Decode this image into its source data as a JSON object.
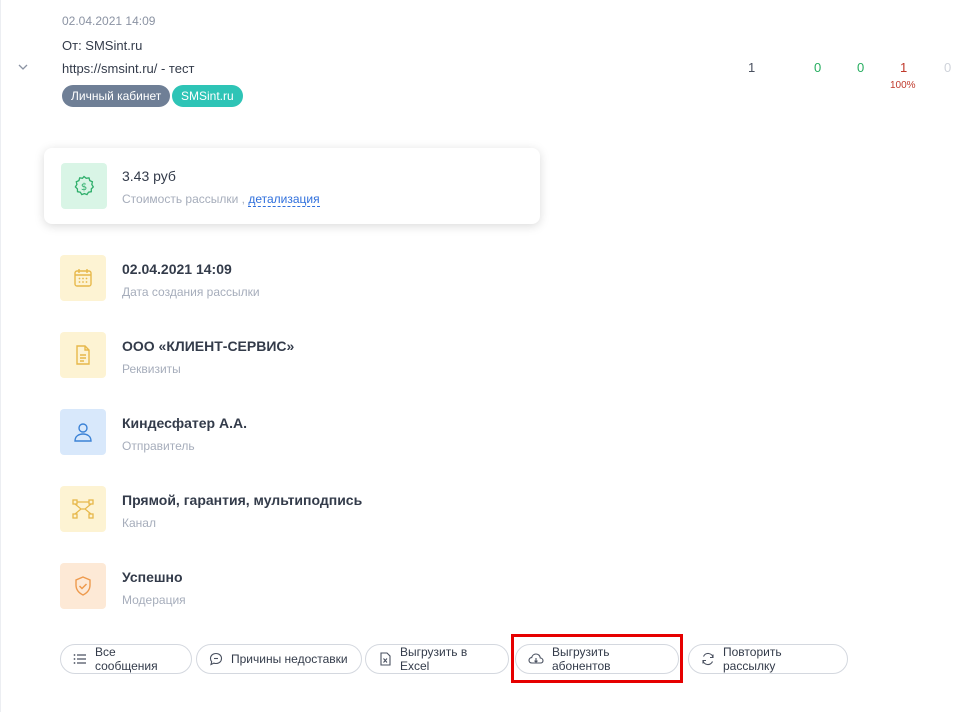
{
  "message": {
    "datetime": "02.04.2021 14:09",
    "from": "От: SMSint.ru",
    "text": "https://smsint.ru/ - тест",
    "tags": [
      "Личный кабинет",
      "SMSint.ru"
    ]
  },
  "stats": {
    "values": [
      "1",
      "0",
      "0",
      "1",
      "0"
    ],
    "percent": "100%",
    "colors": [
      "#4a5160",
      "#27ae60",
      "#27ae60",
      "#c0392b",
      "#cfd3da"
    ]
  },
  "cost": {
    "amount": "3.43 руб",
    "label": "Стоимость рассылки ,",
    "link": "детализация"
  },
  "info": [
    {
      "title": "02.04.2021 14:09",
      "sub": "Дата создания рассылки"
    },
    {
      "title": "ООО «КЛИЕНТ-СЕРВИС»",
      "sub": "Реквизиты"
    },
    {
      "title": "Киндесфатер А.А.",
      "sub": "Отправитель"
    },
    {
      "title": "Прямой, гарантия, мультиподпись",
      "sub": "Канал"
    },
    {
      "title": "Успешно",
      "sub": "Модерация"
    }
  ],
  "buttons": {
    "all_messages": "Все сообщения",
    "reasons": "Причины недоставки",
    "excel": "Выгрузить в Excel",
    "subscribers": "Выгрузить абонентов",
    "repeat": "Повторить рассылку"
  },
  "colors": {
    "green_icon_bg": "#d9f5e6",
    "yellow_icon_bg": "#fdf3d3",
    "blue_icon_bg": "#d8e8fb",
    "orange_icon_bg": "#fde9d6",
    "highlight": "#e60000"
  }
}
